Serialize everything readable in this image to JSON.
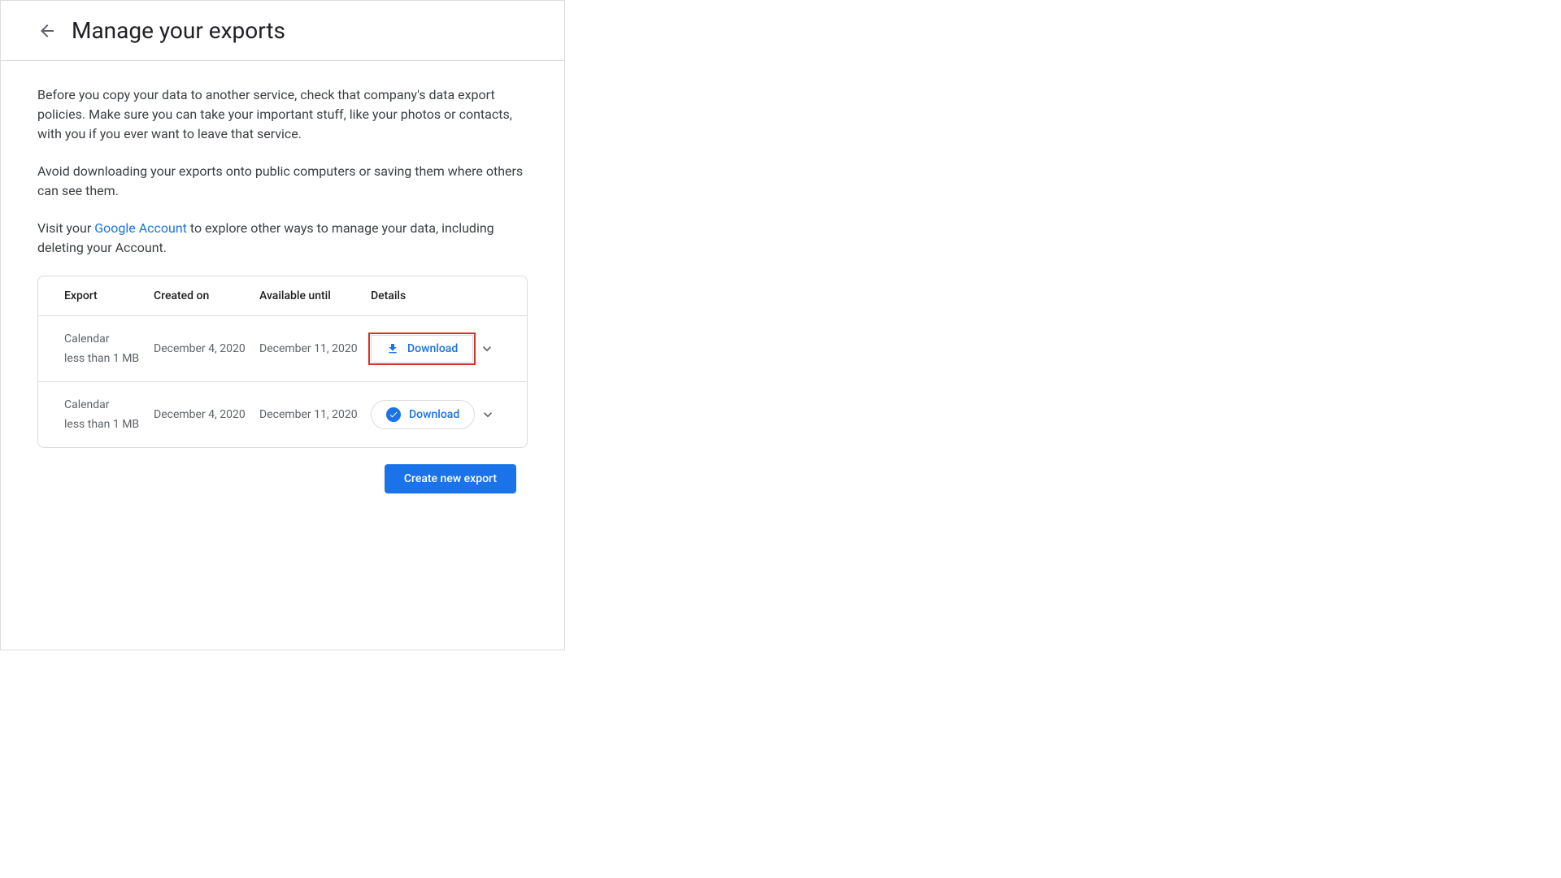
{
  "header": {
    "title": "Manage your exports"
  },
  "intro": {
    "para1": "Before you copy your data to another service, check that company's data export policies. Make sure you can take your important stuff, like your photos or contacts, with you if you ever want to leave that service.",
    "para2": "Avoid downloading your exports onto public computers or saving them where others can see them.",
    "para3_prefix": "Visit your ",
    "para3_link": "Google Account",
    "para3_suffix": " to explore other ways to manage your data, including deleting your Account."
  },
  "table": {
    "headers": {
      "export": "Export",
      "created": "Created on",
      "available": "Available until",
      "details": "Details"
    },
    "rows": [
      {
        "name": "Calendar",
        "size": "less than 1 MB",
        "created": "December 4, 2020",
        "available": "December 11, 2020",
        "download_label": "Download",
        "highlighted": true,
        "icon": "download"
      },
      {
        "name": "Calendar",
        "size": "less than 1 MB",
        "created": "December 4, 2020",
        "available": "December 11, 2020",
        "download_label": "Download",
        "highlighted": false,
        "icon": "check"
      }
    ]
  },
  "actions": {
    "create_new": "Create new export"
  }
}
